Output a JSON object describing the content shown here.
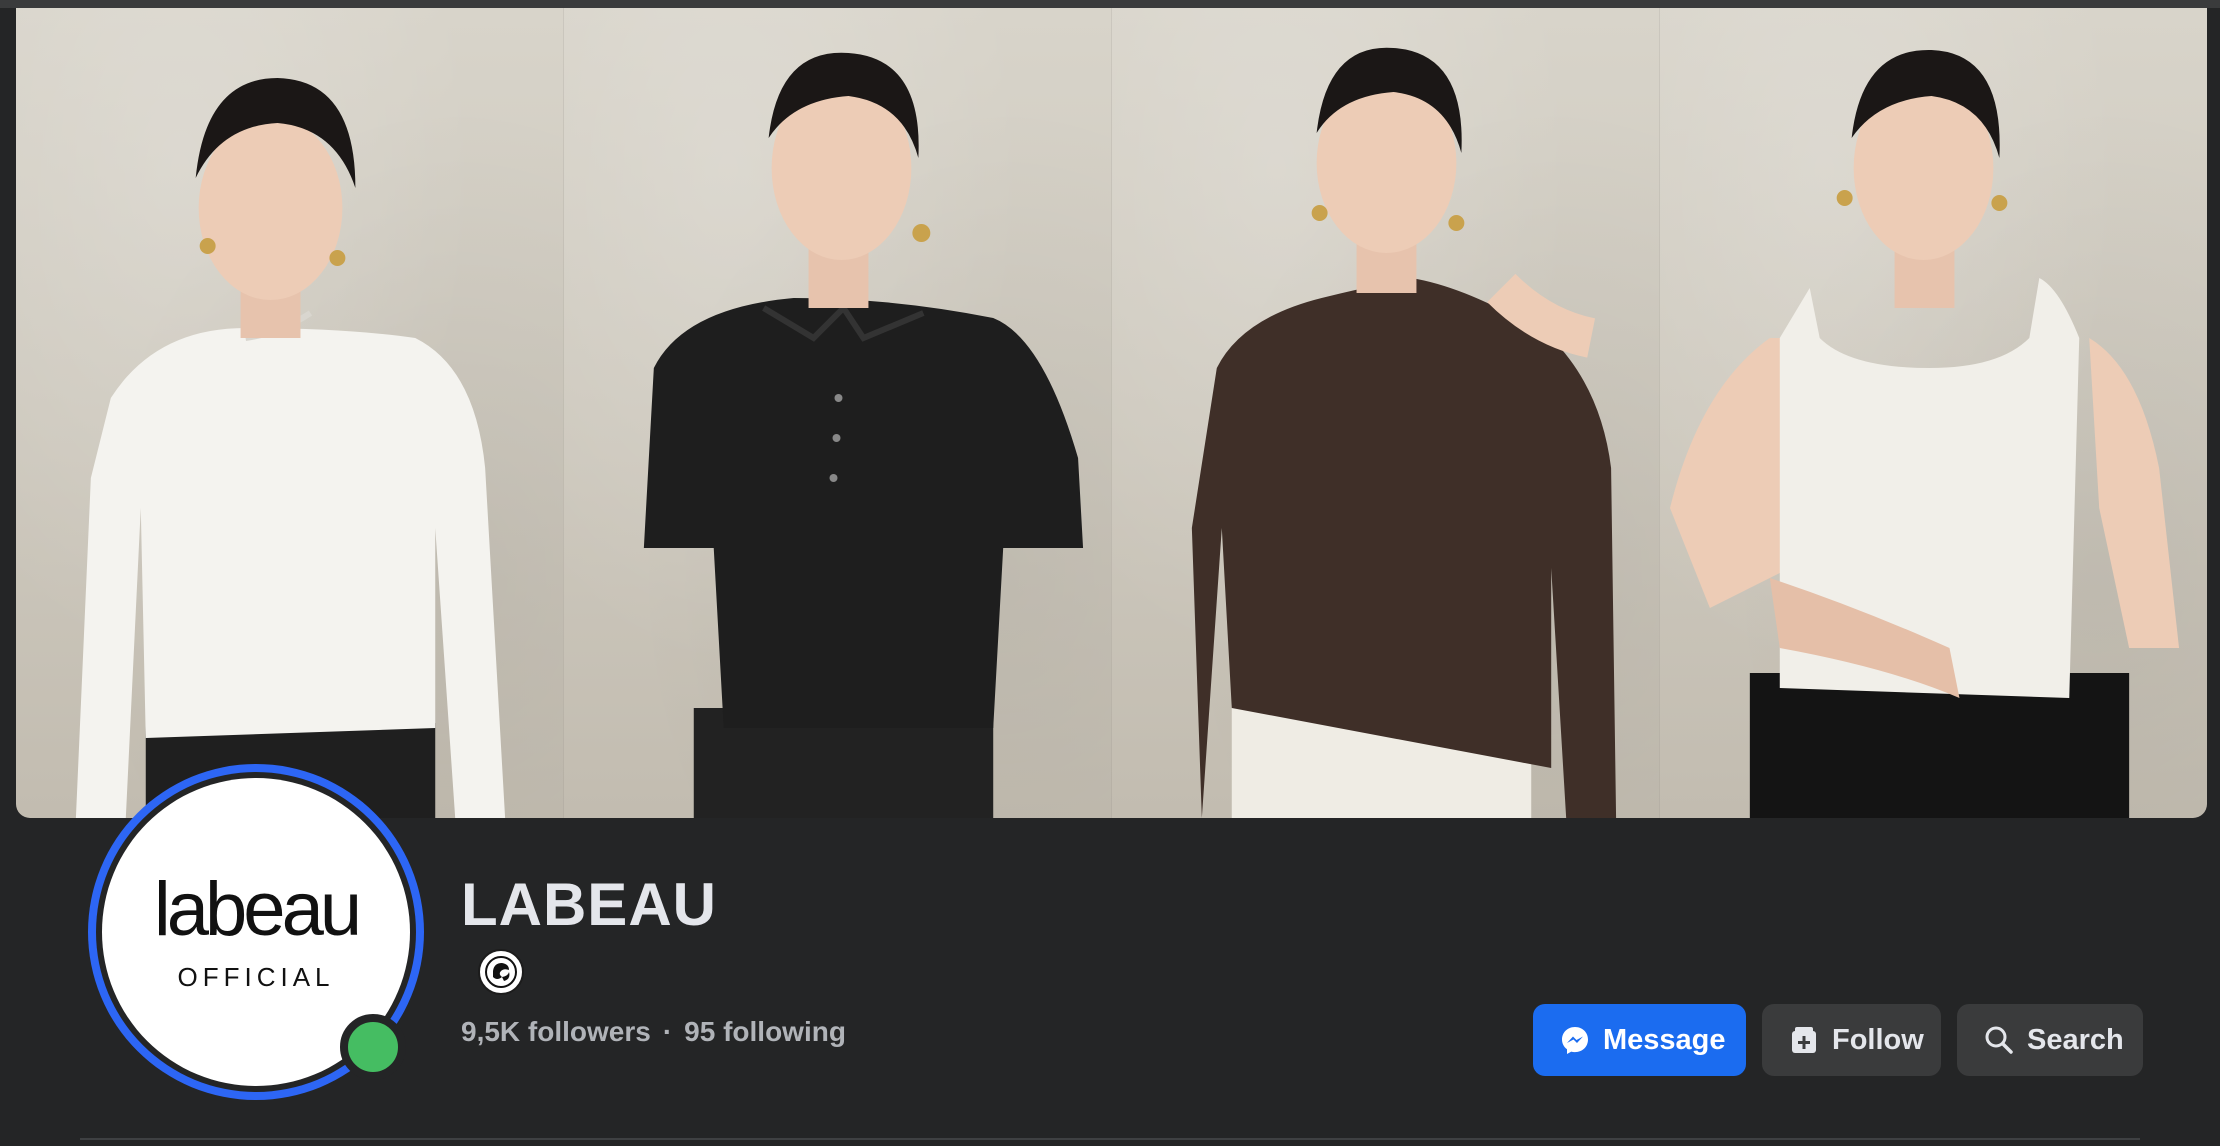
{
  "page": {
    "name": "LABEAU",
    "followers_text": "9,5K followers",
    "separator": "·",
    "following_text": "95 following",
    "avatar": {
      "logo_text": "labeau",
      "logo_subtext": "OFFICIAL",
      "online": true
    },
    "category_icon": "category-badge-icon"
  },
  "actions": {
    "message_label": "Message",
    "follow_label": "Follow",
    "search_label": "Search"
  },
  "cover": {
    "panels": [
      {
        "top_color": "#f4f3ef",
        "description_icon": "model-white-top"
      },
      {
        "top_color": "#1e1e1e",
        "description_icon": "model-black-polo"
      },
      {
        "top_color": "#3f2f28",
        "description_icon": "model-brown-top"
      },
      {
        "top_color": "#f1efe9",
        "description_icon": "model-white-tank"
      }
    ]
  },
  "colors": {
    "background": "#242526",
    "primary_button": "#1b6cf0",
    "secondary_button": "#3a3b3c",
    "avatar_ring": "#2d66f5",
    "online_dot": "#45bd62"
  }
}
